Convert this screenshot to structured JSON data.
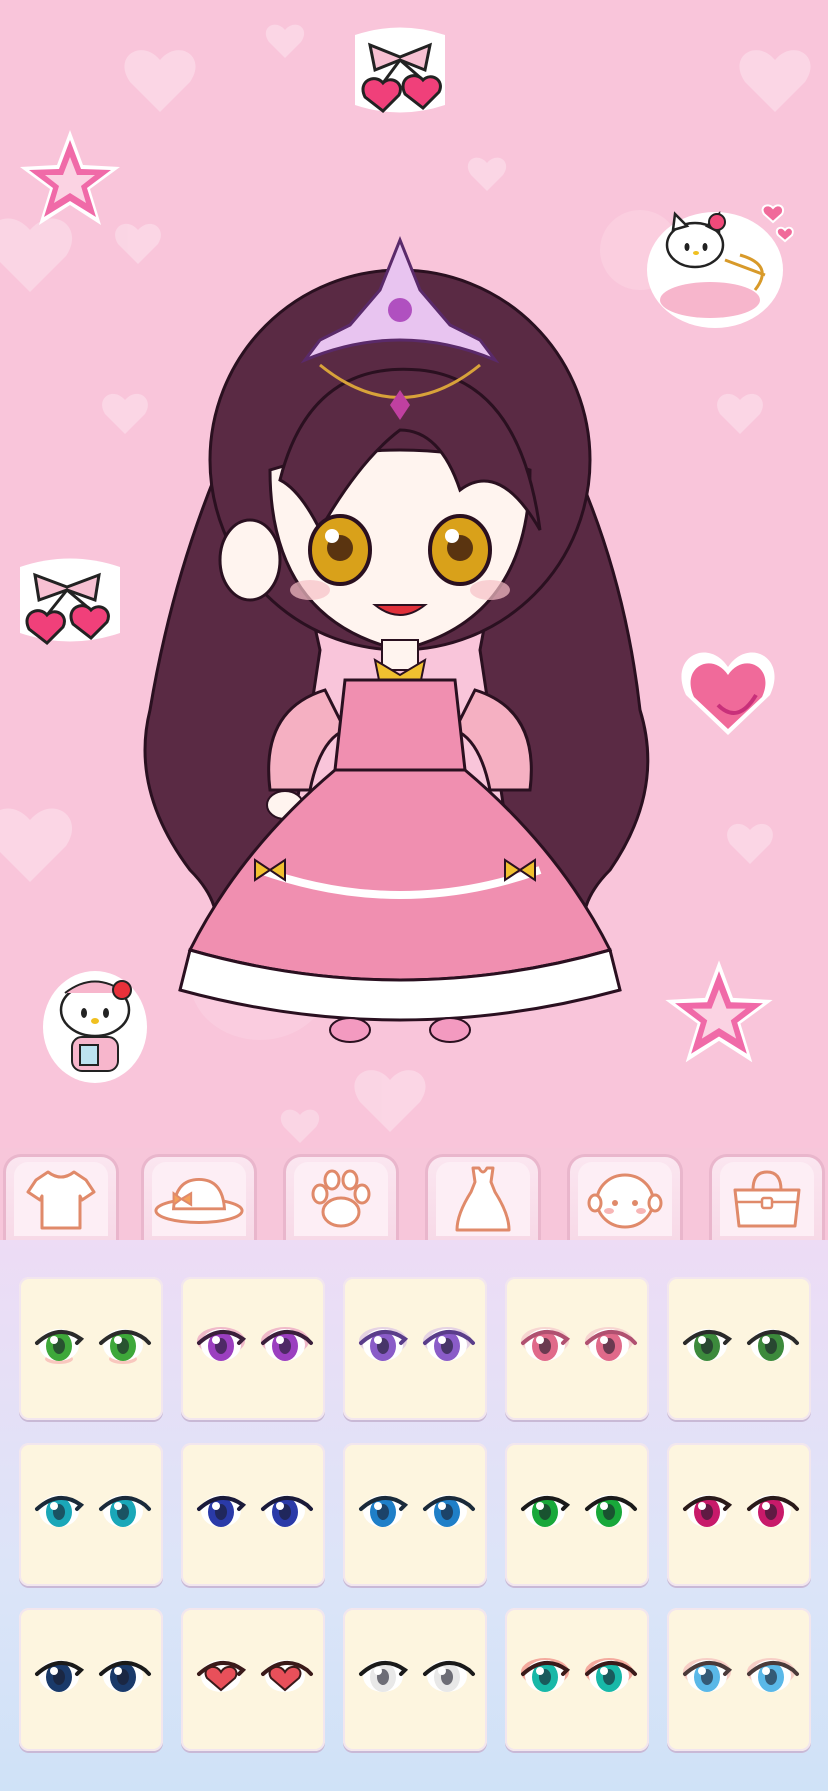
{
  "scene": {
    "background_color": "#f9c5da",
    "character": {
      "hair_color": "#5a2a44",
      "eye_color": "#d9a11a",
      "dress_color": "#f08fb0"
    },
    "stickers": [
      "cherry-bow",
      "pink-star",
      "hello-kitty-cupid",
      "cherry-bow",
      "pink-heart",
      "hello-kitty-nurse",
      "pink-star"
    ]
  },
  "tabs": [
    {
      "id": "tops",
      "icon": "tshirt-icon"
    },
    {
      "id": "hats",
      "icon": "sun-hat-icon"
    },
    {
      "id": "pets",
      "icon": "paw-icon"
    },
    {
      "id": "dresses",
      "icon": "dress-icon"
    },
    {
      "id": "face",
      "icon": "face-icon",
      "selected": true
    },
    {
      "id": "bags",
      "icon": "handbag-icon"
    }
  ],
  "eye_options": [
    {
      "iris": "#3ea83a",
      "lid": "#2b2b2b",
      "blush": true
    },
    {
      "iris": "#9b3fc0",
      "lid": "#3b1f3b",
      "shadow": "#e070b0"
    },
    {
      "iris": "#8a5cc8",
      "lid": "#5a3d8a",
      "shadow": "#c8a8e8"
    },
    {
      "iris": "#e06a8a",
      "lid": "#b05070",
      "shadow": "#f0b0c0"
    },
    {
      "iris": "#3c8a3c",
      "lid": "#2a2a2a"
    },
    {
      "iris": "#1aa7b8",
      "lid": "#1a2a3a"
    },
    {
      "iris": "#2a3aa8",
      "lid": "#1a1a3a"
    },
    {
      "iris": "#1f7fc8",
      "lid": "#1a2a3a"
    },
    {
      "iris": "#18a83a",
      "lid": "#1a1a1a"
    },
    {
      "iris": "#c81a6a",
      "lid": "#2a1a1a"
    },
    {
      "iris": "#1a3a6a",
      "lid": "#1a1a1a"
    },
    {
      "iris": "#e8505a",
      "lid": "#3a1a1a",
      "heart": true
    },
    {
      "iris": "#e8e8e8",
      "lid": "#1a1a1a"
    },
    {
      "iris": "#18b8a8",
      "lid": "#3a1a1a",
      "shadow": "#e85050"
    },
    {
      "iris": "#5ab8e8",
      "lid": "#4a3a3a",
      "shadow": "#f0a0a8"
    }
  ]
}
